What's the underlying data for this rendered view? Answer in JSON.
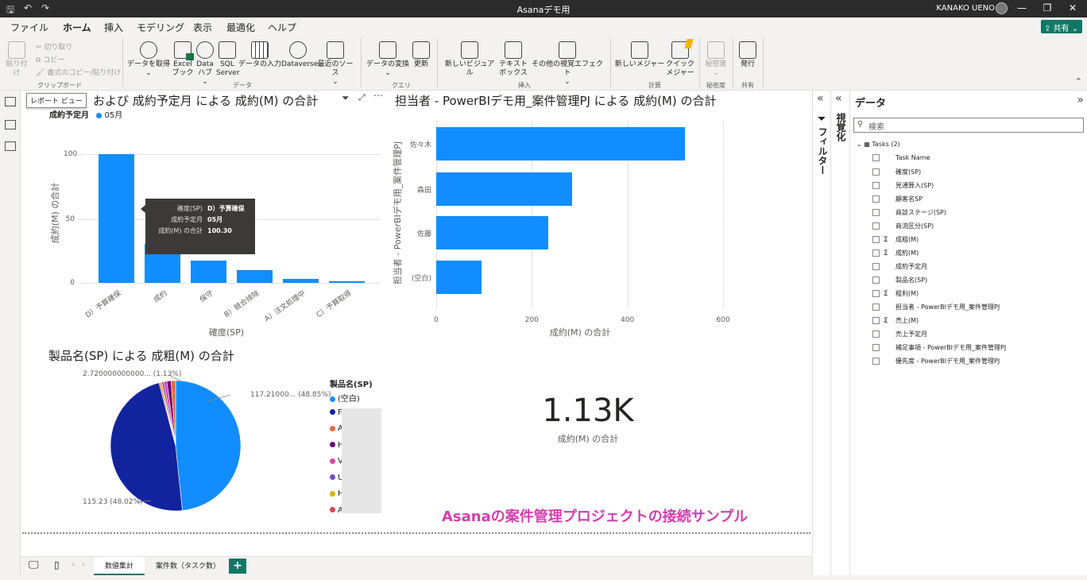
{
  "titlebar": {
    "app_title": "Asanaデモ用",
    "user_name": "KANAKO UENO",
    "save_icon": "save-icon",
    "undo_icon": "undo-icon",
    "redo_icon": "redo-icon",
    "minimize": "—",
    "restore": "❐",
    "close": "✕"
  },
  "menu": {
    "tabs": [
      "ファイル",
      "ホーム",
      "挿入",
      "モデリング",
      "表示",
      "最適化",
      "ヘルプ"
    ],
    "share_label": "共有"
  },
  "ribbon": {
    "clipboard": {
      "paste": "貼り付け",
      "cut": "切り取り",
      "copy": "コピー",
      "format_painter": "書式のコピー/貼り付け",
      "group": "クリップボード"
    },
    "data": {
      "get_data": "データを取得",
      "excel": [
        "Excel",
        "ブック"
      ],
      "datahub": [
        "Data",
        "ハブ"
      ],
      "sql": [
        "SQL",
        "Server"
      ],
      "enter_data": "データの入力",
      "dataverse": "Dataverse",
      "recent": "最近のソース",
      "group": "データ"
    },
    "query": {
      "transform": "データの変換",
      "refresh": "更新",
      "group": "クエリ"
    },
    "insert": {
      "new_visual": "新しいビジュアル",
      "textbox": [
        "テキスト",
        "ボックス"
      ],
      "more_visuals": "その他の視覚エフェクト",
      "group": "挿入"
    },
    "calc": {
      "new_measure": "新しいメジャー",
      "quick_measure": [
        "クイック",
        "メジャー"
      ],
      "group": "計算"
    },
    "sensitivity": {
      "label": "秘密度",
      "group": "秘密度"
    },
    "share": {
      "publish": "発行",
      "group": "共有"
    }
  },
  "leftrail": {
    "tooltip": "レポート ビュー"
  },
  "visual1": {
    "title_visible": "および 成約予定月 による 成約(M) の合計",
    "legend_title": "成約予定月",
    "legend_item": "05月",
    "ylabel": "成約(M) の合計",
    "xlabel": "確度(SP)",
    "yticks": [
      "100",
      "50",
      "0"
    ],
    "tooltip": {
      "rows": [
        {
          "k": "確度(SP)",
          "v": "D）予算確保"
        },
        {
          "k": "成約予定月",
          "v": "05月"
        },
        {
          "k": "成約(M) の合計",
          "v": "100.30"
        }
      ]
    }
  },
  "visual2": {
    "title": "担当者 - PowerBIデモ用_案件管理PJ による 成約(M) の合計",
    "ylabel": "担当者 - PowerBIデモ用_案件管理PJ",
    "xlabel": "成約(M) の合計",
    "xticks": [
      "0",
      "200",
      "400",
      "600"
    ]
  },
  "visual3": {
    "title": "製品名(SP) による 成粗(M) の合計",
    "label_top": "2.720000000000... (1.13%)",
    "label_right": "117.21000... (48.85%)",
    "label_left": "115.23 (48.02%)",
    "legend_title": "製品名(SP)",
    "legend_items": [
      "(空白)",
      "F",
      "A",
      "H",
      "V",
      "U",
      "H",
      "A"
    ]
  },
  "visual4": {
    "value": "1.13K",
    "label": "成約(M) の合計"
  },
  "banner": "Asanaの案件管理プロジェクトの接続サンプル",
  "pages": {
    "tabs": [
      "数値集計",
      "案件数（タスク数）"
    ],
    "add": "+"
  },
  "panes": {
    "filters": "フィルター",
    "visualizations": "視覚化",
    "data_title": "データ",
    "search_placeholder": "検索",
    "table_name": "Tasks (2)",
    "fields": [
      {
        "sig": "",
        "name": "Task Name"
      },
      {
        "sig": "",
        "name": "確度(SP)"
      },
      {
        "sig": "",
        "name": "見通算入(SP)"
      },
      {
        "sig": "",
        "name": "顧客名SP"
      },
      {
        "sig": "",
        "name": "商談ステージ(SP)"
      },
      {
        "sig": "",
        "name": "商流区分(SP)"
      },
      {
        "sig": "Σ",
        "name": "成粗(M)"
      },
      {
        "sig": "Σ",
        "name": "成約(M)"
      },
      {
        "sig": "",
        "name": "成約予定月"
      },
      {
        "sig": "",
        "name": "製品名(SP)"
      },
      {
        "sig": "Σ",
        "name": "粗利(M)"
      },
      {
        "sig": "",
        "name": "担当者 - PowerBIデモ用_案件管理PJ"
      },
      {
        "sig": "Σ",
        "name": "売上(M)"
      },
      {
        "sig": "",
        "name": "売上予定月"
      },
      {
        "sig": "",
        "name": "補足事項 - PowerBIデモ用_案件管理PJ"
      },
      {
        "sig": "",
        "name": "優先度 - PowerBIデモ用_案件管理PJ"
      }
    ]
  },
  "colors": {
    "accent": "#118dff",
    "navy": "#12239e",
    "brand": "#117865",
    "banner": "#d23fae"
  },
  "chart_data": [
    {
      "type": "bar",
      "orientation": "vertical",
      "categories": [
        "D）予算確保",
        "成約",
        "保守",
        "B）競合排除",
        "A）注文処理中",
        "C）予算取得"
      ],
      "series": [
        {
          "name": "05月",
          "values": [
            100.3,
            30,
            17.5,
            10,
            2.8,
            1.2
          ]
        }
      ],
      "ylim": [
        0,
        110
      ],
      "grid": true,
      "legend": "top-left"
    },
    {
      "type": "bar",
      "orientation": "horizontal",
      "categories": [
        "佐々木",
        "森田",
        "佐藤",
        "(空白)"
      ],
      "values": [
        520,
        285,
        235,
        95
      ],
      "xlim": [
        0,
        600
      ],
      "grid": true
    },
    {
      "type": "pie",
      "labels": [
        "(空白)",
        "F",
        "A",
        "H",
        "V",
        "U",
        "H",
        "A"
      ],
      "values": [
        117.21,
        115.23,
        2.72,
        2.5,
        1.8,
        1.2,
        1.0,
        0.8
      ],
      "colors": [
        "#118dff",
        "#12239e",
        "#e66c37",
        "#6b007b",
        "#e044a7",
        "#744ec2",
        "#d9b300",
        "#d64550"
      ],
      "legend": "right"
    }
  ]
}
